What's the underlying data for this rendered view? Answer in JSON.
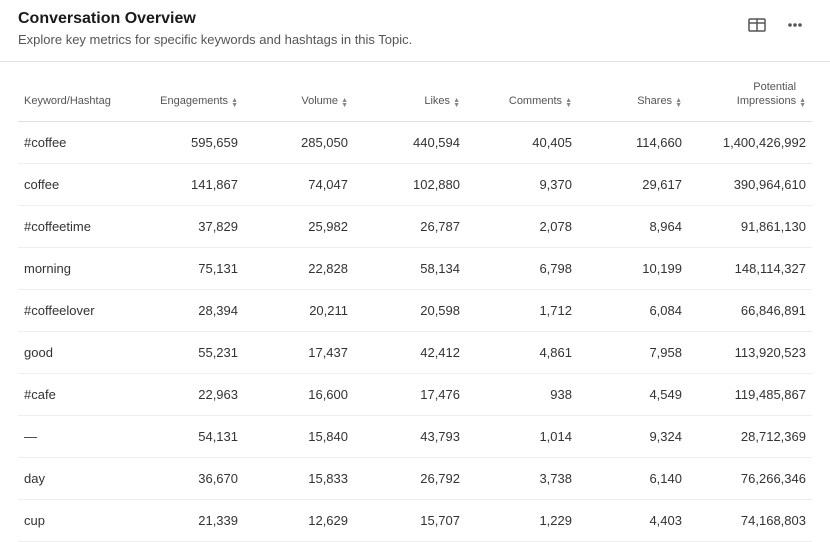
{
  "header": {
    "title": "Conversation Overview",
    "subtitle": "Explore key metrics for specific keywords and hashtags in this Topic."
  },
  "columns": {
    "keyword": "Keyword/Hashtag",
    "engagements": "Engagements",
    "volume": "Volume",
    "likes": "Likes",
    "comments": "Comments",
    "shares": "Shares",
    "potential_impressions_l1": "Potential",
    "potential_impressions_l2": "Impressions"
  },
  "rows": [
    {
      "keyword": "#coffee",
      "engagements": "595,659",
      "volume": "285,050",
      "likes": "440,594",
      "comments": "40,405",
      "shares": "114,660",
      "impressions": "1,400,426,992"
    },
    {
      "keyword": "coffee",
      "engagements": "141,867",
      "volume": "74,047",
      "likes": "102,880",
      "comments": "9,370",
      "shares": "29,617",
      "impressions": "390,964,610"
    },
    {
      "keyword": "#coffeetime",
      "engagements": "37,829",
      "volume": "25,982",
      "likes": "26,787",
      "comments": "2,078",
      "shares": "8,964",
      "impressions": "91,861,130"
    },
    {
      "keyword": "morning",
      "engagements": "75,131",
      "volume": "22,828",
      "likes": "58,134",
      "comments": "6,798",
      "shares": "10,199",
      "impressions": "148,114,327"
    },
    {
      "keyword": "#coffeelover",
      "engagements": "28,394",
      "volume": "20,211",
      "likes": "20,598",
      "comments": "1,712",
      "shares": "6,084",
      "impressions": "66,846,891"
    },
    {
      "keyword": "good",
      "engagements": "55,231",
      "volume": "17,437",
      "likes": "42,412",
      "comments": "4,861",
      "shares": "7,958",
      "impressions": "113,920,523"
    },
    {
      "keyword": "#cafe",
      "engagements": "22,963",
      "volume": "16,600",
      "likes": "17,476",
      "comments": "938",
      "shares": "4,549",
      "impressions": "119,485,867"
    },
    {
      "keyword": "—",
      "engagements": "54,131",
      "volume": "15,840",
      "likes": "43,793",
      "comments": "1,014",
      "shares": "9,324",
      "impressions": "28,712,369"
    },
    {
      "keyword": "day",
      "engagements": "36,670",
      "volume": "15,833",
      "likes": "26,792",
      "comments": "3,738",
      "shares": "6,140",
      "impressions": "76,266,346"
    },
    {
      "keyword": "cup",
      "engagements": "21,339",
      "volume": "12,629",
      "likes": "15,707",
      "comments": "1,229",
      "shares": "4,403",
      "impressions": "74,168,803"
    }
  ]
}
